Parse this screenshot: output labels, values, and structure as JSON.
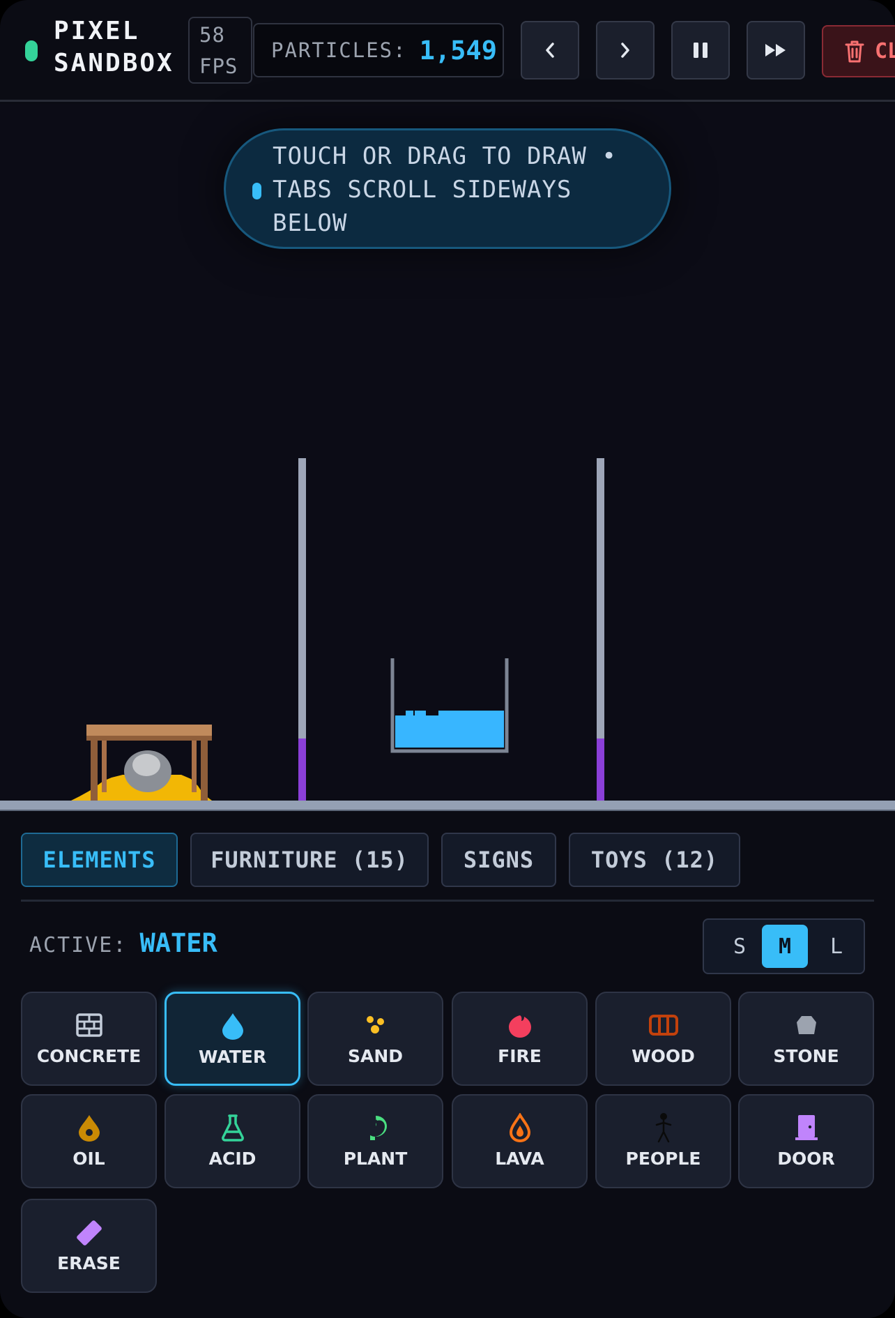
{
  "header": {
    "title_line1": "PIXEL",
    "title_line2": "SANDBOX",
    "fps_value": "58",
    "fps_label": "FPS",
    "particles_label": "PARTICLES:",
    "particles_value": "1,549",
    "clear_label": "CL",
    "controls": [
      "chevron-left-icon",
      "chevron-right-icon",
      "pause-icon",
      "fast-forward-icon",
      "trash-icon"
    ]
  },
  "canvas": {
    "hint_text": "TOUCH OR DRAG TO DRAW • TABS SCROLL SIDEWAYS BELOW",
    "colors": {
      "wall": "#9ea6b8",
      "wall_base": "#8b3fd8",
      "water": "#38b6ff",
      "sand": "#f2b705",
      "ground": "#94a0b4",
      "table": "#b47d54"
    }
  },
  "tabs": [
    {
      "label": "ELEMENTS",
      "active": true
    },
    {
      "label": "FURNITURE (15)",
      "active": false
    },
    {
      "label": "SIGNS",
      "active": false
    },
    {
      "label": "TOYS (12)",
      "active": false
    }
  ],
  "active": {
    "label": "ACTIVE:",
    "value": "WATER"
  },
  "sizes": [
    {
      "label": "S",
      "active": false
    },
    {
      "label": "M",
      "active": true
    },
    {
      "label": "L",
      "active": false
    }
  ],
  "elements": [
    {
      "label": "CONCRETE",
      "icon": "concrete-icon",
      "color": "#c3ccd9",
      "active": false
    },
    {
      "label": "WATER",
      "icon": "water-drop-icon",
      "color": "#38bdf8",
      "active": true
    },
    {
      "label": "SAND",
      "icon": "sand-icon",
      "color": "#fbbf24",
      "active": false
    },
    {
      "label": "FIRE",
      "icon": "fire-icon",
      "color": "#f43f5e",
      "active": false
    },
    {
      "label": "WOOD",
      "icon": "wood-icon",
      "color": "#c2410c",
      "active": false
    },
    {
      "label": "STONE",
      "icon": "stone-icon",
      "color": "#9ca3af",
      "active": false
    },
    {
      "label": "OIL",
      "icon": "oil-icon",
      "color": "#ca8a04",
      "active": false
    },
    {
      "label": "ACID",
      "icon": "flask-icon",
      "color": "#34d399",
      "active": false
    },
    {
      "label": "PLANT",
      "icon": "plant-icon",
      "color": "#4ade80",
      "active": false
    },
    {
      "label": "LAVA",
      "icon": "lava-icon",
      "color": "#f97316",
      "active": false
    },
    {
      "label": "PEOPLE",
      "icon": "person-icon",
      "color": "#0a0a0a",
      "active": false
    },
    {
      "label": "DOOR",
      "icon": "door-icon",
      "color": "#c084fc",
      "active": false
    },
    {
      "label": "ERASE",
      "icon": "eraser-icon",
      "color": "#c084fc",
      "active": false
    }
  ]
}
